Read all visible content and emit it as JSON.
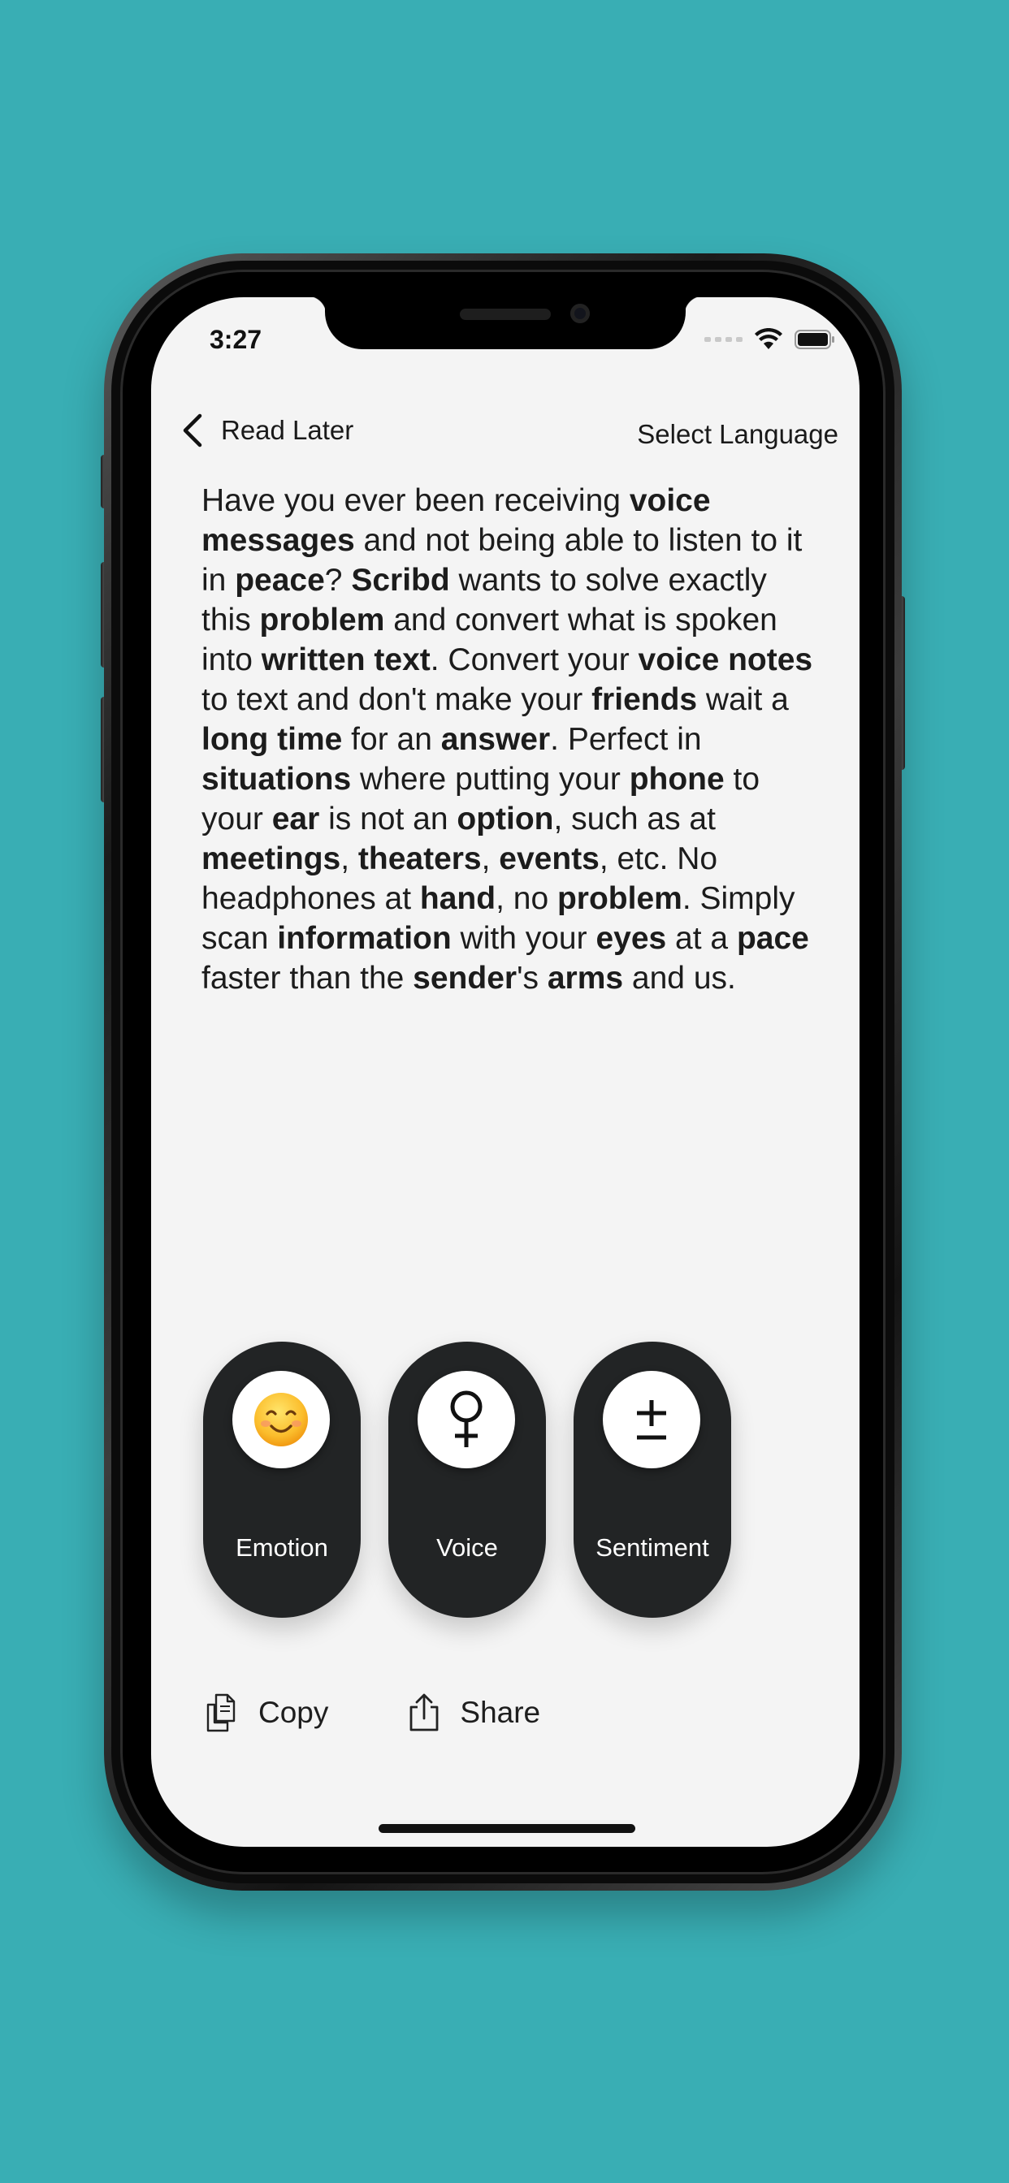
{
  "status_bar": {
    "time": "3:27"
  },
  "nav": {
    "back_label": "Read Later",
    "language_label": "Select Language"
  },
  "transcript": {
    "segments": [
      {
        "t": "Have you ever been receiving ",
        "b": false
      },
      {
        "t": "voice messages",
        "b": true
      },
      {
        "t": " and not being able to listen to it in ",
        "b": false
      },
      {
        "t": "peace",
        "b": true
      },
      {
        "t": "? ",
        "b": false
      },
      {
        "t": "Scribd",
        "b": true
      },
      {
        "t": " wants to solve exactly this ",
        "b": false
      },
      {
        "t": "problem",
        "b": true
      },
      {
        "t": " and convert what is spoken into ",
        "b": false
      },
      {
        "t": "written text",
        "b": true
      },
      {
        "t": ". Convert your ",
        "b": false
      },
      {
        "t": "voice notes",
        "b": true
      },
      {
        "t": " to text and don't make your ",
        "b": false
      },
      {
        "t": "friends",
        "b": true
      },
      {
        "t": " wait a ",
        "b": false
      },
      {
        "t": "long time",
        "b": true
      },
      {
        "t": " for an ",
        "b": false
      },
      {
        "t": "answer",
        "b": true
      },
      {
        "t": ". Perfect in ",
        "b": false
      },
      {
        "t": "situations",
        "b": true
      },
      {
        "t": " where putting your ",
        "b": false
      },
      {
        "t": "phone",
        "b": true
      },
      {
        "t": " to your ",
        "b": false
      },
      {
        "t": "ear",
        "b": true
      },
      {
        "t": " is not an ",
        "b": false
      },
      {
        "t": "option",
        "b": true
      },
      {
        "t": ", such as at ",
        "b": false
      },
      {
        "t": "meetings",
        "b": true
      },
      {
        "t": ", ",
        "b": false
      },
      {
        "t": "theaters",
        "b": true
      },
      {
        "t": ", ",
        "b": false
      },
      {
        "t": "events",
        "b": true
      },
      {
        "t": ", etc. No headphones at ",
        "b": false
      },
      {
        "t": "hand",
        "b": true
      },
      {
        "t": ", no ",
        "b": false
      },
      {
        "t": "problem",
        "b": true
      },
      {
        "t": ". Simply scan ",
        "b": false
      },
      {
        "t": "information",
        "b": true
      },
      {
        "t": " with your ",
        "b": false
      },
      {
        "t": "eyes",
        "b": true
      },
      {
        "t": " at a ",
        "b": false
      },
      {
        "t": "pace",
        "b": true
      },
      {
        "t": " faster than the ",
        "b": false
      },
      {
        "t": "sender",
        "b": true
      },
      {
        "t": "'s ",
        "b": false
      },
      {
        "t": "arms",
        "b": true
      },
      {
        "t": " and us.",
        "b": false
      }
    ]
  },
  "features": [
    {
      "label": "Emotion",
      "icon": "smiling-face-icon",
      "glyph": ""
    },
    {
      "label": "Voice",
      "icon": "female-sign-icon",
      "glyph": "♀"
    },
    {
      "label": "Sentiment",
      "icon": "plus-minus-icon",
      "glyph": "±"
    }
  ],
  "actions": {
    "copy_label": "Copy",
    "share_label": "Share"
  },
  "colors": {
    "background": "#39aeb4",
    "screen": "#f4f4f4",
    "pill": "#222425"
  }
}
